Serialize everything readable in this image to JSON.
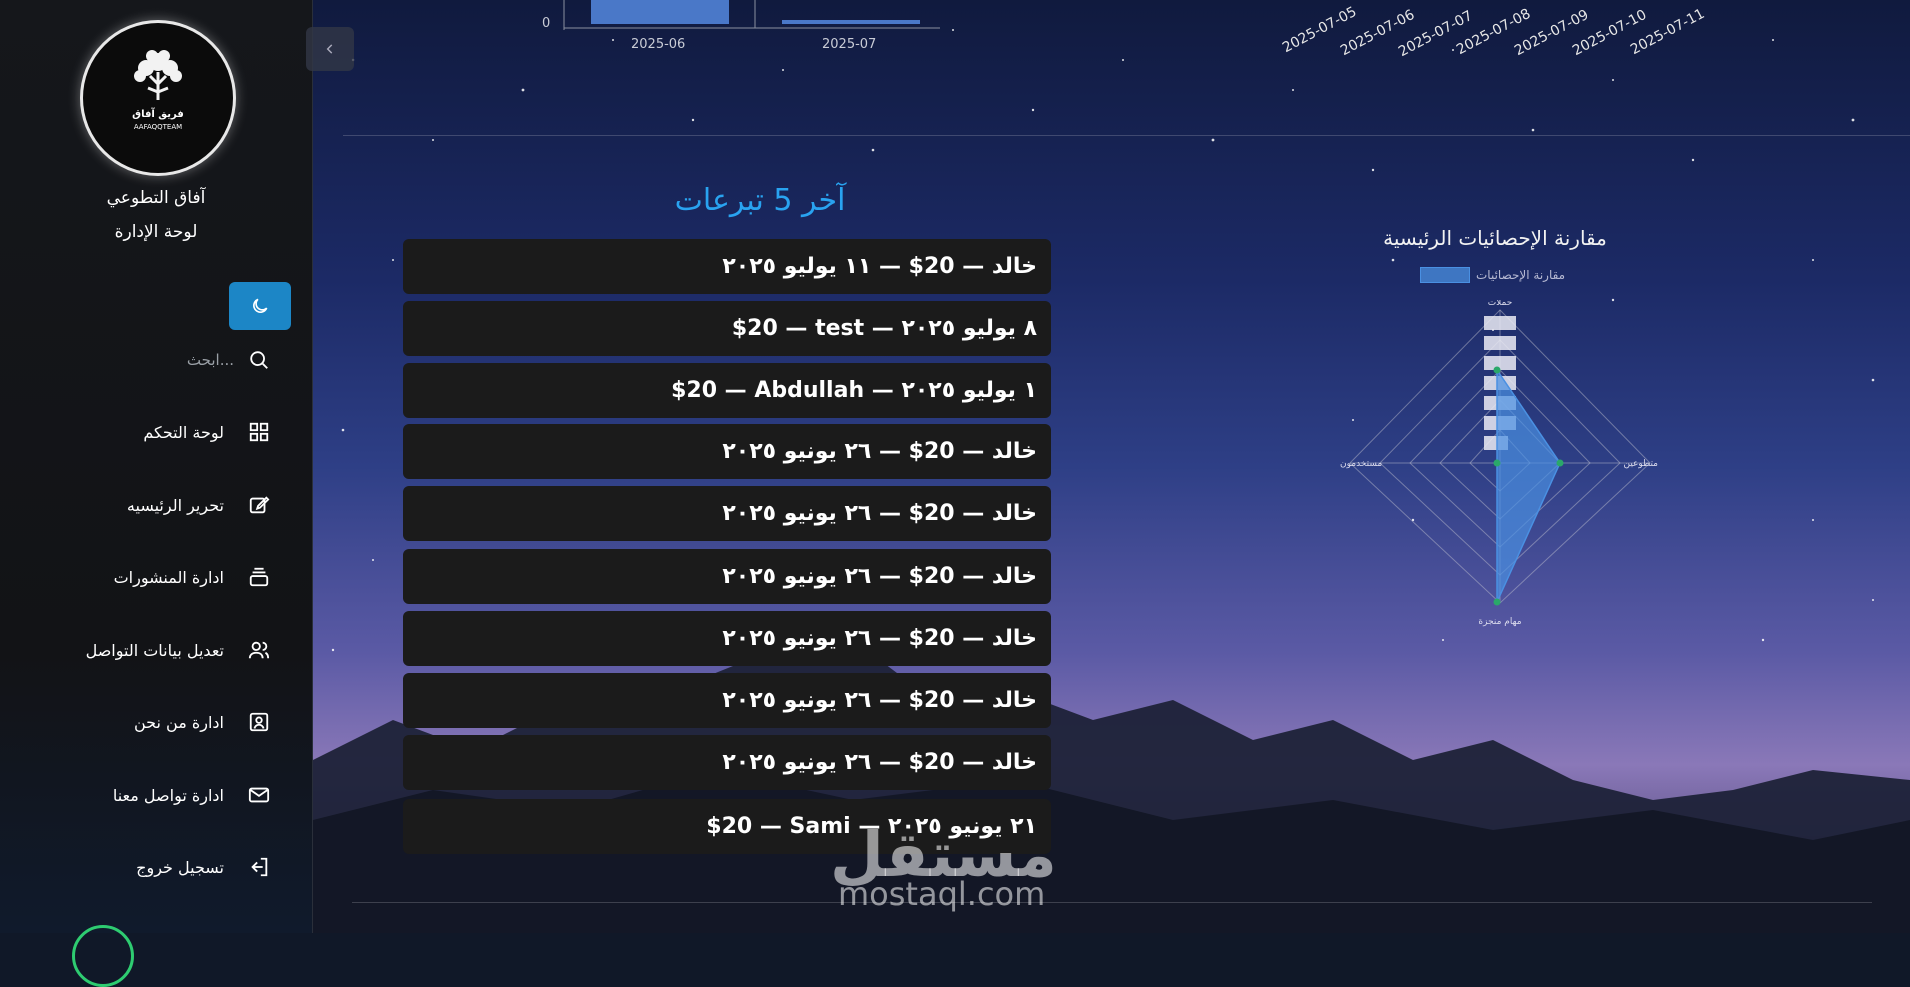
{
  "sidebar": {
    "logo_text": "فريق آفاق",
    "logo_sub": "AAFAQQTEAM",
    "org_name": "آفاق التطوعي",
    "panel_name": "لوحة الإدارة",
    "search_placeholder": "ابحث...",
    "items": [
      {
        "label": "لوحة التحكم",
        "icon": "grid-icon"
      },
      {
        "label": "تحرير الرئيسيه",
        "icon": "edit-icon"
      },
      {
        "label": "ادارة المنشورات",
        "icon": "layers-icon"
      },
      {
        "label": "تعديل بيانات التواصل",
        "icon": "users-icon"
      },
      {
        "label": "ادارة من نحن",
        "icon": "user-card-icon"
      },
      {
        "label": "ادارة تواصل معنا",
        "icon": "mail-icon"
      },
      {
        "label": "تسجيل خروج",
        "icon": "logout-icon"
      }
    ]
  },
  "bar_chart": {
    "y_tick": "0",
    "x_ticks": [
      "2025-06",
      "2025-07"
    ]
  },
  "date_axis": [
    "2025-07-05",
    "2025-07-06",
    "2025-07-07",
    "2025-07-08",
    "2025-07-09",
    "2025-07-10",
    "2025-07-11"
  ],
  "donations": {
    "title": "آخر 5 تبرعات",
    "items": [
      "خالد — 20$ — ١١ يوليو ٢٠٢٥",
      "$20 — test — ٨ يوليو ٢٠٢٥",
      "$20 — Abdullah — ١ يوليو ٢٠٢٥",
      "خالد — 20$ — ٢٦ يونيو ٢٠٢٥",
      "خالد — 20$ — ٢٦ يونيو ٢٠٢٥",
      "خالد — 20$ — ٢٦ يونيو ٢٠٢٥",
      "خالد — 20$ — ٢٦ يونيو ٢٠٢٥",
      "خالد — 20$ — ٢٦ يونيو ٢٠٢٥",
      "خالد — 20$ — ٢٦ يونيو ٢٠٢٥",
      "$20 — Sami — ٢١ يونيو ٢٠٢٥"
    ]
  },
  "radar": {
    "title": "مقارنة الإحصائيات الرئيسية",
    "legend": "مقارنة الإحصائيات",
    "axes": [
      "حملات",
      "متطوعين",
      "مهام منجزة",
      "مستخدمون"
    ],
    "accent": "#4a90e2"
  },
  "watermark": {
    "main": "مستقل",
    "sub": "mostaql.com"
  }
}
